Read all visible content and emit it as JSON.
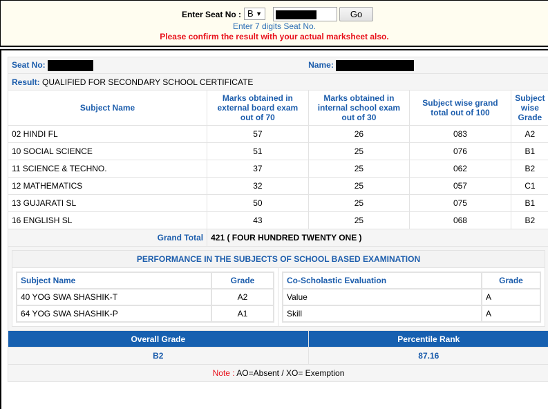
{
  "search": {
    "label": "Enter Seat No :",
    "series_selected": "B",
    "seat_value": "",
    "go_label": "Go",
    "hint": "Enter 7 digits Seat No.",
    "warning": "Please confirm the result with your actual marksheet also."
  },
  "student": {
    "seat_label": "Seat No:",
    "name_label": "Name:",
    "result_label": "Result:",
    "result_value": "QUALIFIED FOR SECONDARY SCHOOL CERTIFICATE"
  },
  "marks": {
    "headers": [
      "Subject Name",
      "Marks obtained in external board exam out of 70",
      "Marks obtained in internal school exam out of 30",
      "Subject wise grand total out of 100",
      "Subject wise Grade"
    ],
    "rows": [
      {
        "subject": "02 HINDI FL",
        "external": "57",
        "internal": "26",
        "total": "083",
        "grade": "A2"
      },
      {
        "subject": "10 SOCIAL SCIENCE",
        "external": "51",
        "internal": "25",
        "total": "076",
        "grade": "B1"
      },
      {
        "subject": "11 SCIENCE & TECHNO.",
        "external": "37",
        "internal": "25",
        "total": "062",
        "grade": "B2"
      },
      {
        "subject": "12 MATHEMATICS",
        "external": "32",
        "internal": "25",
        "total": "057",
        "grade": "C1"
      },
      {
        "subject": "13 GUJARATI SL",
        "external": "50",
        "internal": "25",
        "total": "075",
        "grade": "B1"
      },
      {
        "subject": "16 ENGLISH SL",
        "external": "43",
        "internal": "25",
        "total": "068",
        "grade": "B2"
      }
    ],
    "grand_total_label": "Grand Total",
    "grand_total_value": "421 ( FOUR HUNDRED TWENTY ONE )"
  },
  "school_based": {
    "title": "PERFORMANCE IN THE SUBJECTS OF SCHOOL BASED EXAMINATION",
    "subjects_headers": [
      "Subject Name",
      "Grade"
    ],
    "subjects": [
      {
        "name": "40 YOG SWA SHASHIK-T",
        "grade": "A2"
      },
      {
        "name": "64 YOG SWA SHASHIK-P",
        "grade": "A1"
      }
    ],
    "co_headers": [
      "Co-Scholastic Evaluation",
      "Grade"
    ],
    "co_scholastic": [
      {
        "name": "Value",
        "grade": "A"
      },
      {
        "name": "Skill",
        "grade": "A"
      }
    ]
  },
  "overall": {
    "grade_label": "Overall Grade",
    "percentile_label": "Percentile Rank",
    "grade_value": "B2",
    "percentile_value": "87.16"
  },
  "note": {
    "label": "Note :",
    "text": " AO=Absent / XO= Exemption"
  }
}
